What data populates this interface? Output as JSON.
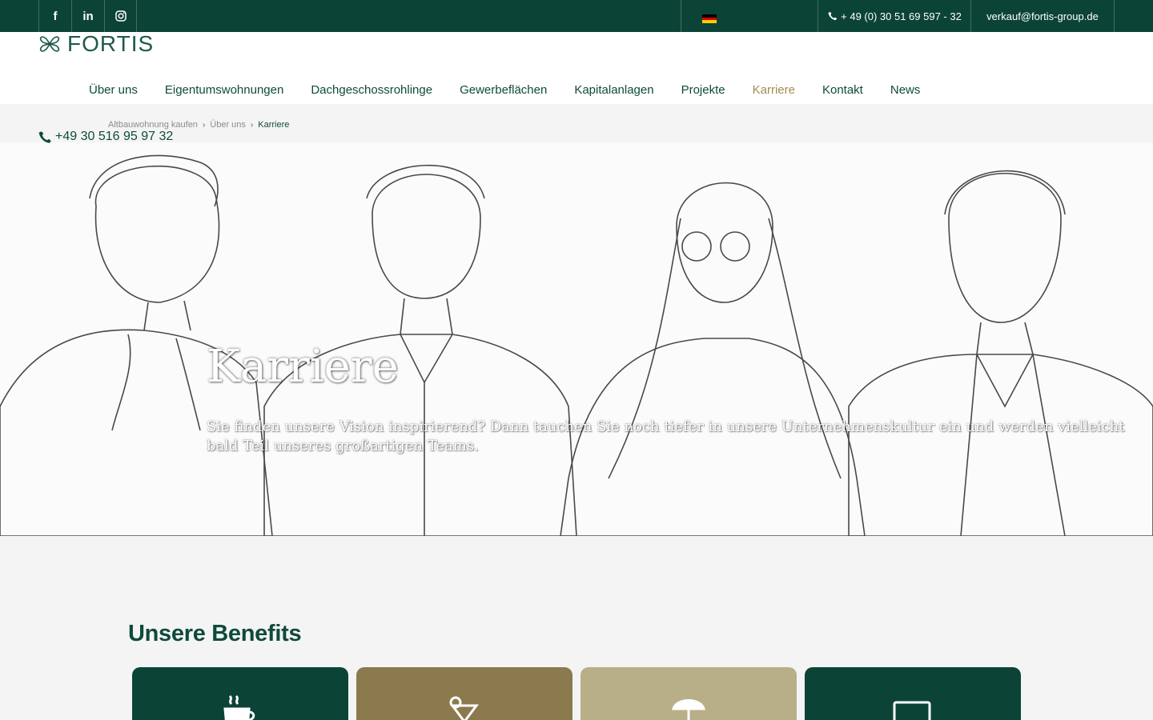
{
  "topbar": {
    "social": [
      {
        "icon": "facebook-icon",
        "glyph": "f"
      },
      {
        "icon": "linkedin-icon",
        "glyph": "in"
      },
      {
        "icon": "instagram-icon",
        "glyph": "◎"
      }
    ],
    "language_flag": "german-flag-icon",
    "phone": "+ 49 (0) 30 51 69 597 - 32",
    "email": "verkauf@fortis-group.de"
  },
  "header": {
    "logo_text": "FORTIS",
    "nav": [
      {
        "label": "Über uns",
        "active": false
      },
      {
        "label": "Eigentumswohnungen",
        "active": false
      },
      {
        "label": "Dachgeschossrohlinge",
        "active": false
      },
      {
        "label": "Gewerbeflächen",
        "active": false
      },
      {
        "label": "Kapitalanlagen",
        "active": false
      },
      {
        "label": "Projekte",
        "active": false
      },
      {
        "label": "Karriere",
        "active": true
      },
      {
        "label": "Kontakt",
        "active": false
      },
      {
        "label": "News",
        "active": false
      }
    ]
  },
  "breadcrumb": {
    "items": [
      "Altbauwohnung kaufen",
      "Über uns",
      "Karriere"
    ]
  },
  "hotline": "+49 30 516 95 97 32",
  "hero": {
    "title": "Karriere",
    "text": "Sie finden unsere Vision inspirierend? Dann tauchen Sie noch tiefer in unsere Unternehmenskultur ein und werden vielleicht bald Teil unseres großartigen Teams."
  },
  "benefits": {
    "title": "Unsere Benefits",
    "cards": [
      {
        "icon": "coffee-cup-icon",
        "color": "#0b4437"
      },
      {
        "icon": "cocktail-icon",
        "color": "#8a7a4e"
      },
      {
        "icon": "beach-umbrella-icon",
        "color": "#b8af88"
      },
      {
        "icon": "laptop-icon",
        "color": "#0b4437"
      }
    ]
  },
  "colors": {
    "primary": "#0b4437",
    "accent": "#a68a50",
    "background": "#f4f4f4"
  }
}
